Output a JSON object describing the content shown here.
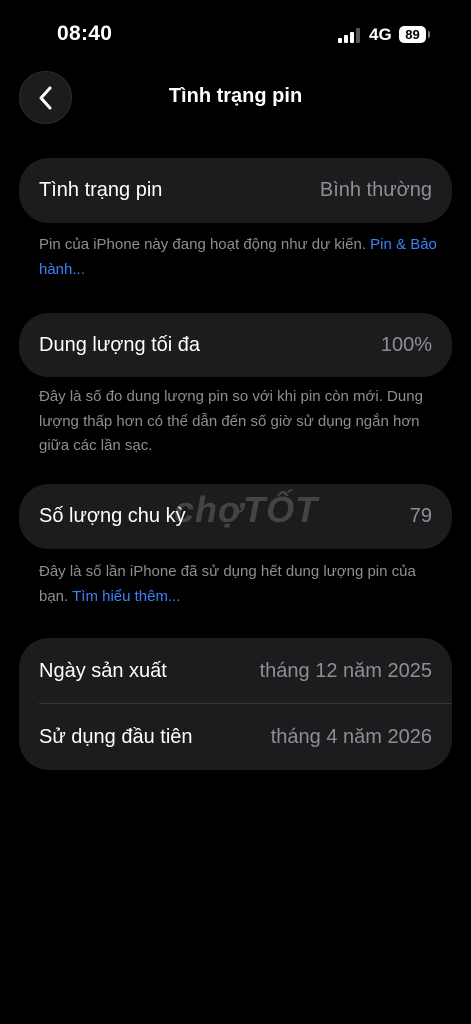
{
  "status_bar": {
    "time": "08:40",
    "network": "4G",
    "battery": "89",
    "signal_bars_active": 3,
    "signal_bars_total": 4
  },
  "nav": {
    "title": "Tình trạng pin",
    "back_icon": "chevron-left-icon"
  },
  "battery_health": {
    "label": "Tình trạng pin",
    "value": "Bình thường",
    "footnote": "Pin của iPhone này đang hoạt động như dự kiến.",
    "footnote_link": "Pin & Bảo hành..."
  },
  "max_capacity": {
    "label": "Dung lượng tối đa",
    "value": "100%",
    "footnote": "Đây là số đo dung lượng pin so với khi pin còn mới. Dung lượng thấp hơn có thể dẫn đến số giờ sử dụng ngắn hơn giữa các lần sạc."
  },
  "cycle_count": {
    "label": "Số lượng chu kỳ",
    "value": "79",
    "footnote": "Đây là số lần iPhone đã sử dụng hết dung lượng pin của bạn.",
    "footnote_link": "Tìm hiểu thêm..."
  },
  "dates": {
    "manufacture_label": "Ngày sản xuất",
    "manufacture_value": "tháng 12 năm 2025",
    "first_use_label": "Sử dụng đầu tiên",
    "first_use_value": "tháng 4 năm 2026"
  },
  "watermark": "chợTỐT",
  "colors": {
    "background": "#000000",
    "card": "#1c1c1e",
    "secondary_text": "#8e8e93",
    "link": "#3a82f7"
  }
}
